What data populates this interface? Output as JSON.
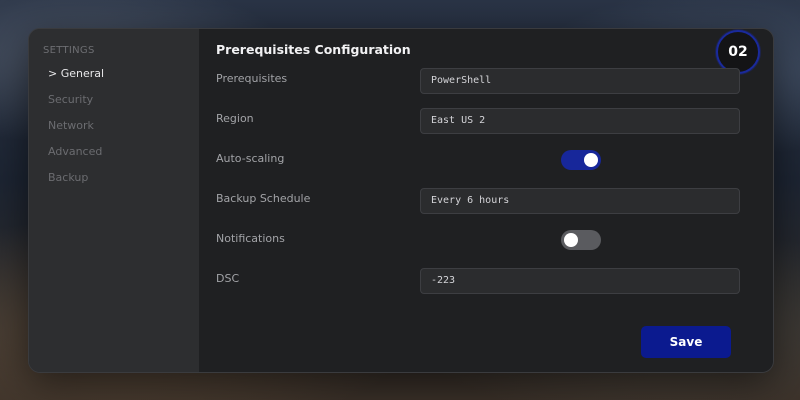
{
  "sidebar": {
    "heading": "SETTINGS",
    "items": [
      {
        "label": "> General",
        "active": true
      },
      {
        "label": "Security",
        "active": false
      },
      {
        "label": "Network",
        "active": false
      },
      {
        "label": "Advanced",
        "active": false
      },
      {
        "label": "Backup",
        "active": false
      }
    ]
  },
  "header": {
    "title": "Prerequisites Configuration",
    "step": "02"
  },
  "form": {
    "prerequisites": {
      "label": "Prerequisites",
      "value": "PowerShell"
    },
    "region": {
      "label": "Region",
      "value": "East US 2"
    },
    "auto_scaling": {
      "label": "Auto-scaling",
      "enabled": true
    },
    "backup_schedule": {
      "label": "Backup Schedule",
      "value": "Every 6 hours"
    },
    "notifications": {
      "label": "Notifications",
      "enabled": false
    },
    "dsc": {
      "label": "DSC",
      "value": "-223"
    }
  },
  "actions": {
    "save_label": "Save"
  },
  "colors": {
    "accent": "#0b1a8f",
    "toggle_on": "#17279a",
    "toggle_off": "#5a5b5f"
  }
}
